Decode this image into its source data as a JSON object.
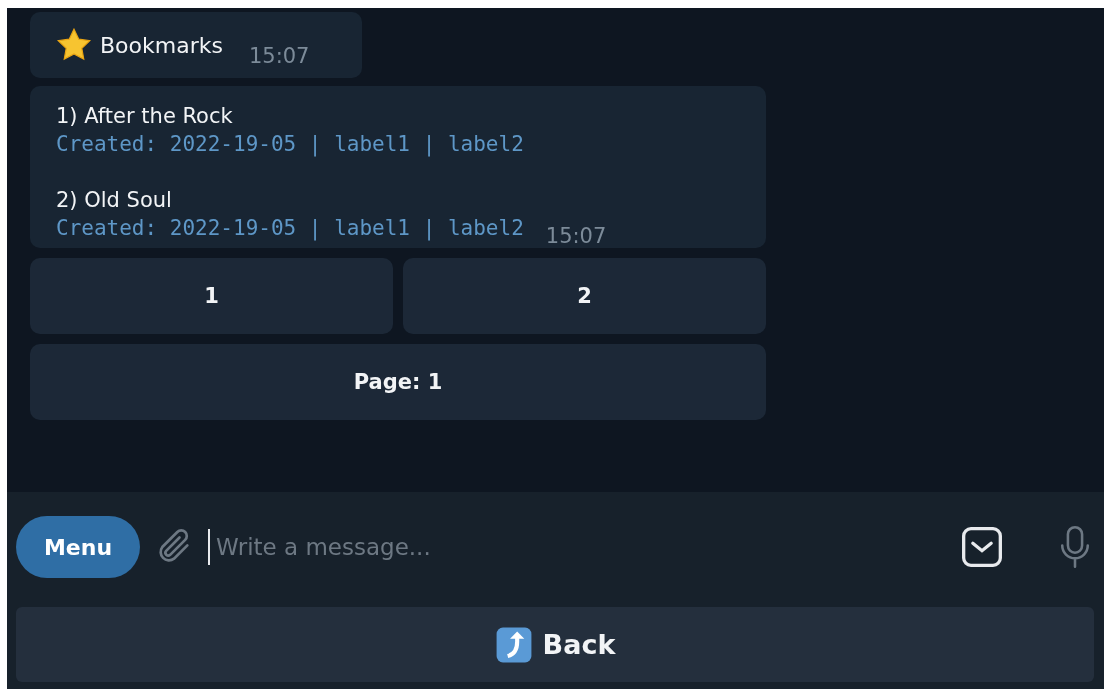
{
  "messages": [
    {
      "kind": "header",
      "text": "Bookmarks",
      "time": "15:07"
    },
    {
      "kind": "list",
      "items": [
        {
          "title": "1) After the Rock",
          "meta": "Created: 2022-19-05 | label1 | label2"
        },
        {
          "title": "2) Old Soul",
          "meta": "Created: 2022-19-05 | label1 | label2"
        }
      ],
      "time": "15:07"
    }
  ],
  "inline_buttons": [
    [
      "1",
      "2"
    ],
    [
      "Page: 1"
    ]
  ],
  "composer": {
    "menu_button": "Menu",
    "placeholder": "Write a message..."
  },
  "reply_keyboard": [
    "Back"
  ]
}
